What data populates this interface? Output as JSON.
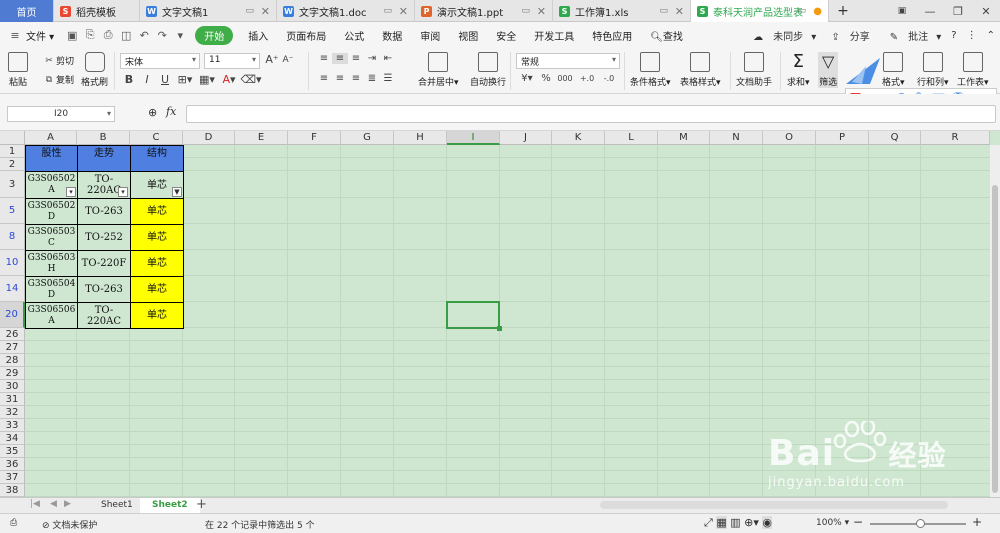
{
  "tabs": [
    {
      "label": "首页"
    },
    {
      "label": "稻壳模板"
    },
    {
      "label": "文字文稿1"
    },
    {
      "label": "文字文稿1.doc"
    },
    {
      "label": "演示文稿1.ppt"
    },
    {
      "label": "工作簿1.xls"
    },
    {
      "label": "泰科天润产品选型表"
    }
  ],
  "menu": {
    "file": "文件",
    "start": "开始",
    "items": [
      "插入",
      "页面布局",
      "公式",
      "数据",
      "审阅",
      "视图",
      "安全",
      "开发工具",
      "特色应用"
    ],
    "search": "查找",
    "sync": "未同步",
    "share": "分享",
    "annotate": "批注"
  },
  "ribbon": {
    "paste": "粘贴",
    "cut": "剪切",
    "copy": "复制",
    "format_painter": "格式刷",
    "font_name": "宋体",
    "font_size": "11",
    "merge": "合并居中",
    "wrap": "自动换行",
    "num_format": "常规",
    "cond_format": "条件格式",
    "table_style": "表格样式",
    "doc_helper": "文档助手",
    "sum": "求和",
    "filter": "筛选",
    "format": "格式",
    "rowcol": "行和列",
    "worksheet": "工作表"
  },
  "formula_bar": {
    "name_box": "I20",
    "fx": "fx"
  },
  "columns": [
    "A",
    "B",
    "C",
    "D",
    "E",
    "F",
    "G",
    "H",
    "I",
    "J",
    "K",
    "L",
    "M",
    "N",
    "O",
    "P",
    "Q",
    "R"
  ],
  "row_numbers": [
    "1",
    "2",
    "3",
    "5",
    "8",
    "10",
    "14",
    "20",
    "26",
    "27",
    "28",
    "29",
    "30",
    "31",
    "32",
    "33",
    "34",
    "35",
    "36",
    "37",
    "38"
  ],
  "table": {
    "headers": [
      "股性",
      "走势",
      "结构"
    ],
    "rows": [
      [
        "G3S06502A",
        "TO-220AC",
        "单芯"
      ],
      [
        "G3S06502D",
        "TO-263",
        "单芯"
      ],
      [
        "G3S06503C",
        "TO-252",
        "单芯"
      ],
      [
        "G3S06503H",
        "TO-220F",
        "单芯"
      ],
      [
        "G3S06504D",
        "TO-263",
        "单芯"
      ],
      [
        "G3S06506A",
        "TO-220AC",
        "单芯"
      ]
    ]
  },
  "sheets": [
    "Sheet1",
    "Sheet2"
  ],
  "status": {
    "protect": "文档未保护",
    "filter_info": "在 22 个记录中筛选出 5 个",
    "zoom": "100%"
  },
  "watermark": {
    "brand": "Bai",
    "brand_cn": "经验",
    "url": "jingyan.baidu.com"
  },
  "colors": {
    "header_blue": "#4f7fe0",
    "yellow": "#ffff00",
    "accent_green": "#3fae48",
    "grid_bg": "#cfe7d1"
  }
}
